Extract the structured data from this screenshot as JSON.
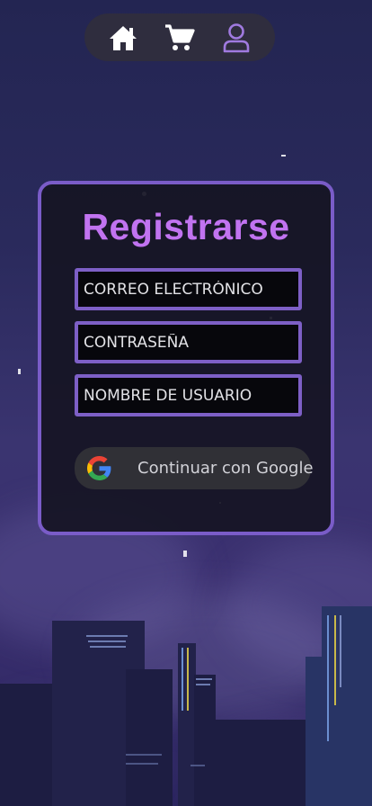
{
  "nav": {
    "items": [
      {
        "icon": "home-icon",
        "color": "#ffffff"
      },
      {
        "icon": "cart-icon",
        "color": "#ffffff"
      },
      {
        "icon": "user-icon",
        "color": "#a07ae0",
        "active": true
      }
    ]
  },
  "form": {
    "title": "Registrarse",
    "email_placeholder": "CORREO ELECTRÓNICO",
    "password_placeholder": "CONTRASEÑA",
    "username_placeholder": "NOMBRE DE USUARIO",
    "google_label": "Continuar con Google"
  },
  "colors": {
    "accent": "#7a5cc8",
    "title": "#c173f0",
    "card": "#16142a",
    "nav": "#2f2d3e"
  }
}
